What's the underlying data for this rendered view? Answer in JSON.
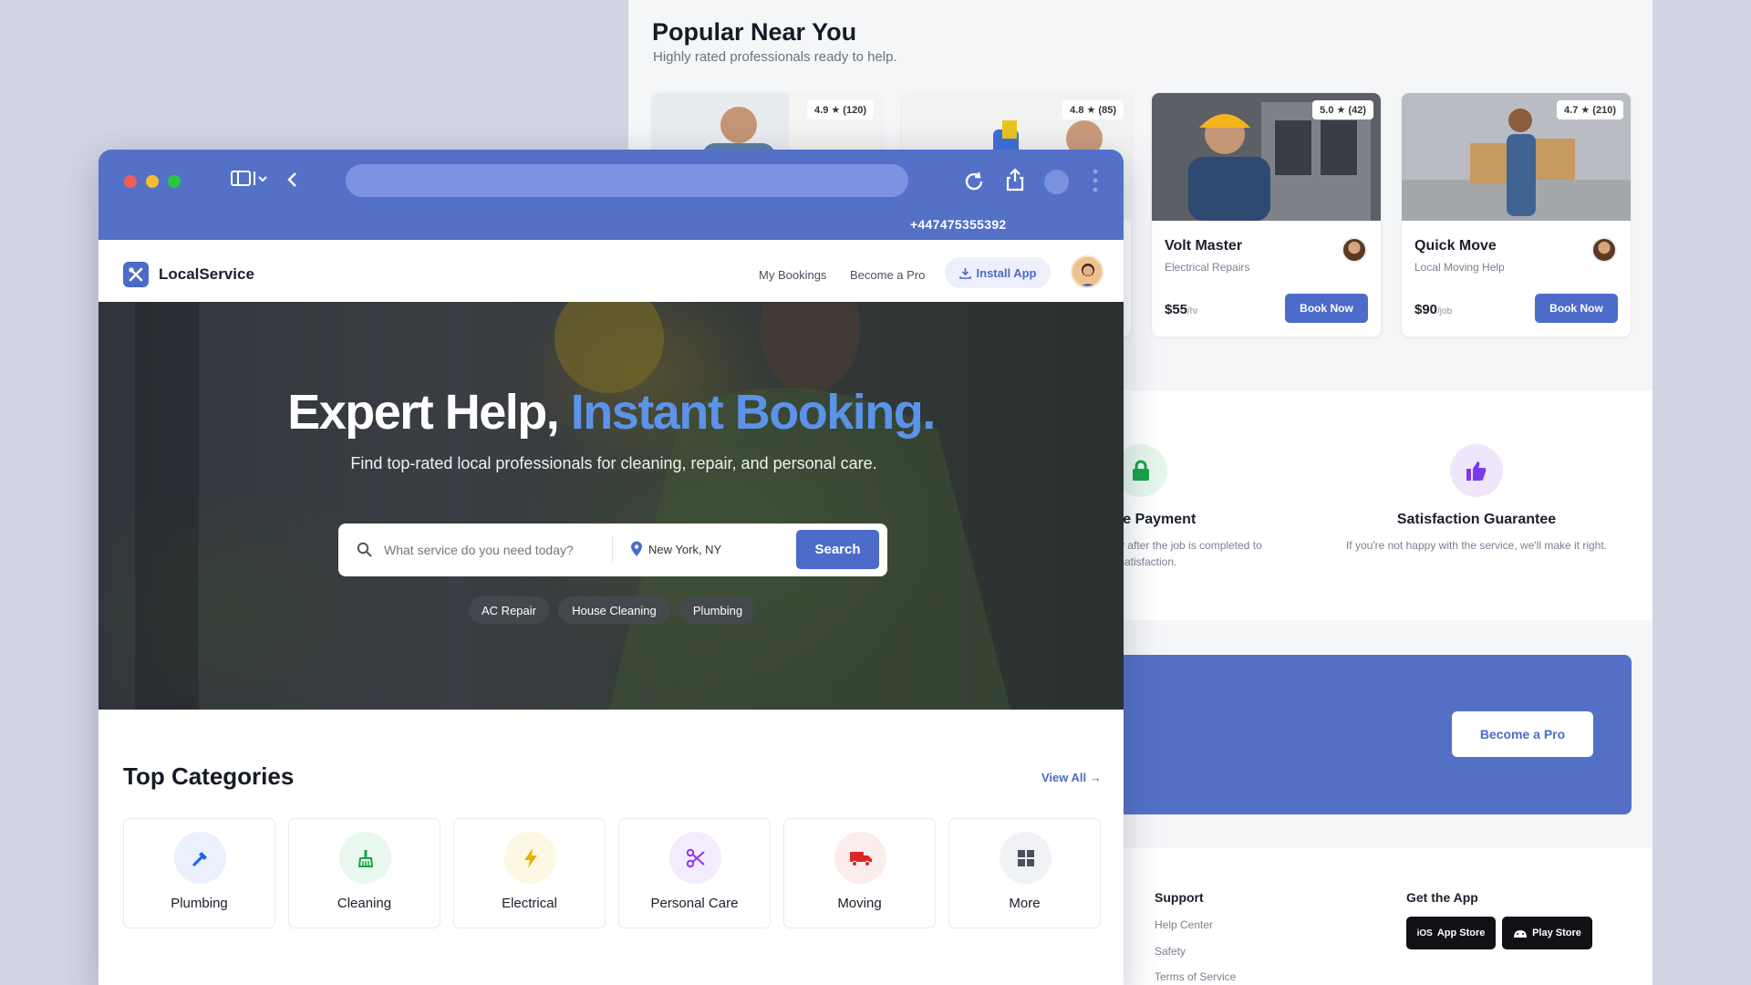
{
  "background_page": {
    "title": "Popular Near You",
    "subtitle": "Highly rated professionals ready to help.",
    "pros": [
      {
        "rating": "4.9 ★ (120)",
        "name": "",
        "role": "",
        "price": "",
        "unit": "",
        "cta": ""
      },
      {
        "rating": "4.8 ★ (85)",
        "name": "",
        "role": "",
        "price": "",
        "unit": "",
        "cta": ""
      },
      {
        "rating": "5.0 ★ (42)",
        "name": "Volt Master",
        "role": "Electrical Repairs",
        "price": "$55",
        "unit": "/hr",
        "cta": "Book Now"
      },
      {
        "rating": "4.7 ★ (210)",
        "name": "Quick Move",
        "role": "Local Moving Help",
        "price": "$90",
        "unit": "/job",
        "cta": "Book Now"
      }
    ],
    "trust": [
      {
        "title": "re Payment",
        "text": "y after the job is completed to satisfaction.",
        "icon": "lock-icon",
        "color": "#16a34a"
      },
      {
        "title": "Satisfaction Guarantee",
        "text": "If you're not happy with the service, we'll make it right.",
        "icon": "thumbs-up-icon",
        "color": "#7c3aed"
      }
    ],
    "banner_cta": "Become a Pro",
    "footer": {
      "support_head": "Support",
      "support_links": [
        "Help Center",
        "Safety",
        "Terms of Service"
      ],
      "app_head": "Get the App",
      "app_store": "App Store",
      "app_store_prefix": "iOS",
      "play_store": "Play Store"
    }
  },
  "browser": {
    "phone": "+447475355392",
    "nav": {
      "logo": "LocalService",
      "bookings": "My Bookings",
      "become_pro": "Become a Pro",
      "install": "Install App"
    },
    "hero": {
      "title_main": "Expert Help, ",
      "title_accent": "Instant Booking.",
      "subtitle": "Find top-rated local professionals for cleaning, repair, and personal care.",
      "search_placeholder": "What service do you need today?",
      "location": "New York, NY",
      "search_button": "Search",
      "chips": [
        "AC Repair",
        "House Cleaning",
        "Plumbing"
      ]
    },
    "categories": {
      "title": "Top Categories",
      "view_all": "View All →",
      "items": [
        {
          "label": "Plumbing",
          "icon": "wrench-icon",
          "color": "#2563eb",
          "bg": "#eaf1fd"
        },
        {
          "label": "Cleaning",
          "icon": "broom-icon",
          "color": "#16a34a",
          "bg": "#e9f8ee"
        },
        {
          "label": "Electrical",
          "icon": "bolt-icon",
          "color": "#eab308",
          "bg": "#fdf8e4"
        },
        {
          "label": "Personal Care",
          "icon": "scissors-icon",
          "color": "#9333ea",
          "bg": "#f4ecfd"
        },
        {
          "label": "Moving",
          "icon": "truck-icon",
          "color": "#dc2626",
          "bg": "#fdecec"
        },
        {
          "label": "More",
          "icon": "grid-icon",
          "color": "#4b5060",
          "bg": "#f1f2f5"
        }
      ]
    }
  }
}
